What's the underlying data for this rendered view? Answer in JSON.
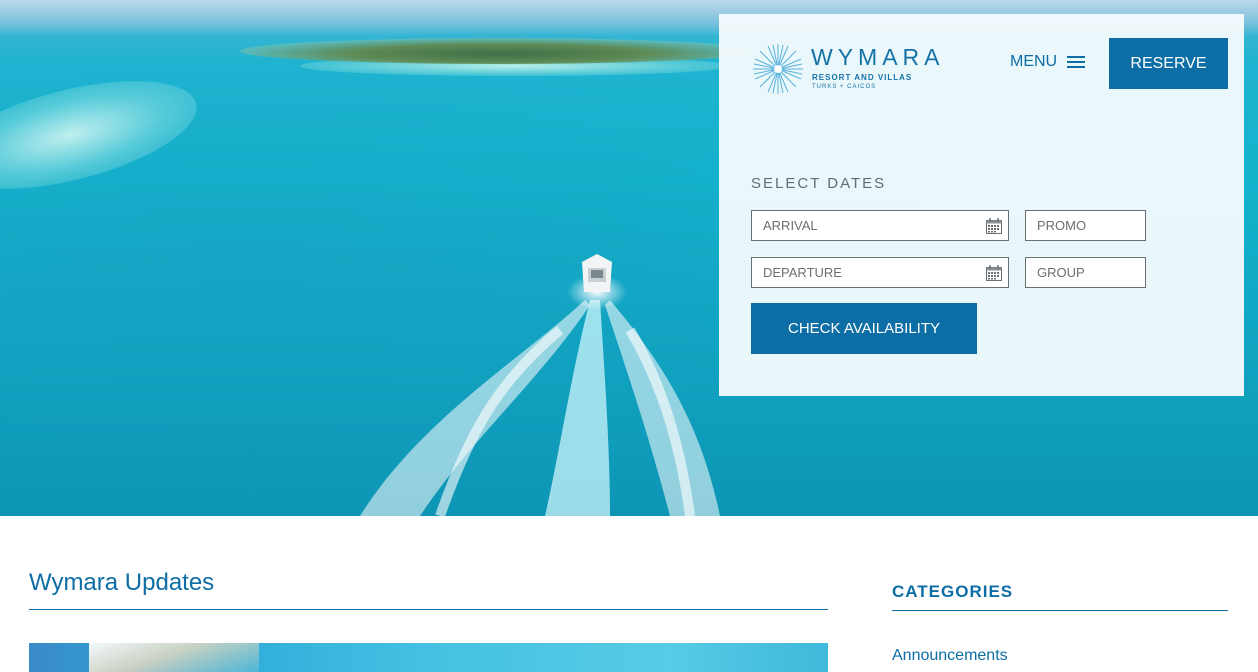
{
  "brand": {
    "name": "WYMARA",
    "tagline": "RESORT AND VILLAS",
    "location": "TURKS + CAICOS"
  },
  "header": {
    "menu_label": "MENU",
    "reserve_label": "RESERVE"
  },
  "booking": {
    "heading": "SELECT DATES",
    "arrival_placeholder": "ARRIVAL",
    "departure_placeholder": "DEPARTURE",
    "promo_placeholder": "PROMO",
    "group_placeholder": "GROUP",
    "check_label": "CHECK AVAILABILITY"
  },
  "main": {
    "section_title": "Wymara Updates"
  },
  "sidebar": {
    "categories_title": "CATEGORIES",
    "categories": [
      {
        "label": "Announcements"
      }
    ]
  },
  "colors": {
    "accent": "#0d6ea6",
    "panel_bg": "#f6fbfd",
    "field_border": "#6b6f72"
  },
  "icons": {
    "menu": "hamburger-icon",
    "calendar": "calendar-icon",
    "logo": "sunburst-logo-icon"
  }
}
